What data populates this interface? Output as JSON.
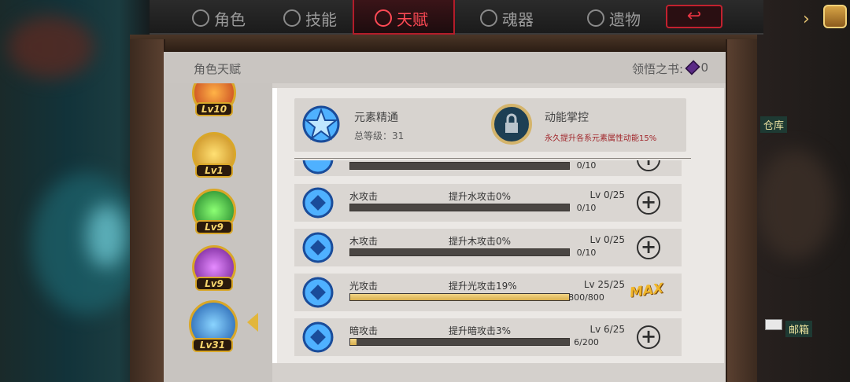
{
  "tabs": [
    {
      "label": "角色",
      "icon": "character-icon",
      "active": false
    },
    {
      "label": "技能",
      "icon": "skill-icon",
      "active": false
    },
    {
      "label": "天赋",
      "icon": "talent-icon",
      "active": true
    },
    {
      "label": "魂器",
      "icon": "soul-icon",
      "active": false
    },
    {
      "label": "遗物",
      "icon": "relic-icon",
      "active": false
    }
  ],
  "panel": {
    "title": "角色天赋",
    "book_label": "领悟之书:",
    "book_count": "0"
  },
  "sidebar": {
    "items": [
      {
        "level": "Lv10",
        "color": "#e0541c"
      },
      {
        "level": "Lv1",
        "color": "#e3b52a"
      },
      {
        "level": "Lv9",
        "color": "#39c24a"
      },
      {
        "level": "Lv9",
        "color": "#b03ad8"
      },
      {
        "level": "Lv31",
        "color": "#2c86e0",
        "selected": true
      }
    ]
  },
  "summary": {
    "name": "元素精通",
    "total": "总等级：31",
    "locked_title": "动能掌控",
    "locked_desc": "永久提升各系元素属性动能15%"
  },
  "rows": [
    {
      "name": "",
      "desc": "",
      "level": "",
      "progress": "0/10",
      "fill": 0,
      "max": false
    },
    {
      "name": "水攻击",
      "desc": "提升水攻击0%",
      "level": "Lv 0/25",
      "progress": "0/10",
      "fill": 0,
      "max": false
    },
    {
      "name": "木攻击",
      "desc": "提升木攻击0%",
      "level": "Lv 0/25",
      "progress": "0/10",
      "fill": 0,
      "max": false
    },
    {
      "name": "光攻击",
      "desc": "提升光攻击19%",
      "level": "Lv 25/25",
      "progress": "800/800",
      "fill": 1,
      "max": true
    },
    {
      "name": "暗攻击",
      "desc": "提升暗攻击3%",
      "level": "Lv 6/25",
      "progress": "6/200",
      "fill": 0.03,
      "max": false
    }
  ],
  "max_label": "MAX",
  "right": {
    "warehouse": "仓库",
    "mail": "邮箱"
  },
  "colors": {
    "accent": "#ff4a55",
    "gold": "#d9b04f",
    "panel": "#d4d0cc"
  }
}
